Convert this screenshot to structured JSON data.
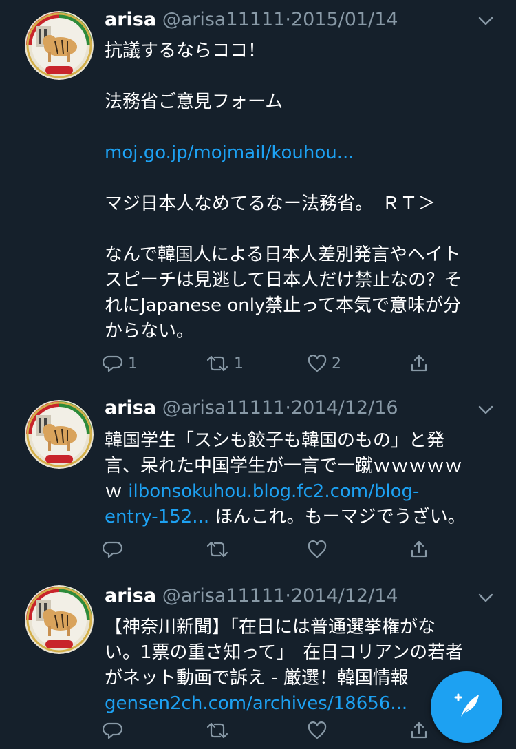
{
  "colors": {
    "background": "#15202b",
    "text": "#ffffff",
    "secondary_text": "#8899a6",
    "link": "#1da1f2",
    "divider": "#38444d",
    "fab": "#1da1f2"
  },
  "tweets": [
    {
      "name": "arisa",
      "handle": "@arisa11111",
      "separator": "·",
      "date": "2015/01/14",
      "lines": {
        "l1": "抗議するならココ！",
        "l2": "法務省ご意見フォーム",
        "l3_link": "moj.go.jp/mojmail/kouhou...",
        "l4": "マジ日本人なめてるなー法務省。　ＲＴ＞",
        "l5": "なんで韓国人による日本人差別発言やヘイト",
        "l6": "スピーチは見逃して日本人だけ禁止なの？そ",
        "l7": "れにJapanese only禁止って本気で意味が分",
        "l8": "からない。"
      },
      "counts": {
        "reply": "1",
        "retweet": "1",
        "like": "2"
      }
    },
    {
      "name": "arisa",
      "handle": "@arisa11111",
      "separator": "·",
      "date": "2014/12/16",
      "lines": {
        "l1": "韓国学生「スシも餃子も韓国のもの」と発",
        "l2": "言、呆れた中国学生が一言で一蹴ｗｗｗｗｗ",
        "l3_pre": "ｗ ",
        "l3_link": "ilbonsokuhou.blog.fc2.com/blog-",
        "l4_link": "entry-152...",
        "l4_post": " ほんこれ。もーマジでうざい。"
      },
      "counts": {
        "reply": "",
        "retweet": "",
        "like": ""
      }
    },
    {
      "name": "arisa",
      "handle": "@arisa11111",
      "separator": "·",
      "date": "2014/12/14",
      "lines": {
        "l1": "【神奈川新聞】「在日には普通選挙権がな",
        "l2": "い。1票の重さ知って」　在日コリアンの若者",
        "l3": "がネット動画で訴え - 厳選！韓国情報",
        "l4_link": "gensen2ch.com/archives/18656..."
      },
      "counts": {
        "reply": "",
        "retweet": "",
        "like": ""
      }
    }
  ],
  "icons": {
    "avatar": "avatar-image",
    "chevron": "chevron-down-icon",
    "reply": "reply-icon",
    "retweet": "retweet-icon",
    "like": "heart-icon",
    "share": "share-icon",
    "fab": "compose-feather-icon"
  },
  "avatar_badge_text": "NC1978"
}
